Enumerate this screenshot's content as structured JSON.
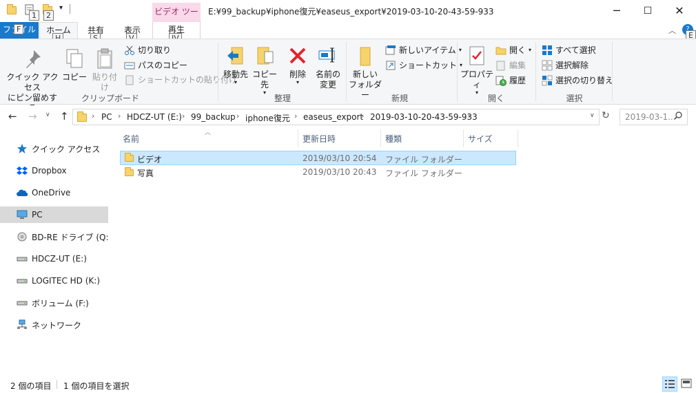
{
  "titlebar": {
    "window_title": "E:¥99_backup¥iphone復元¥easeus_export¥2019-03-10-20-43-59-933",
    "context_tab": "ビデオ ツール",
    "keytips": [
      "1",
      "2"
    ],
    "minimize": "─",
    "maximize": "☐",
    "close": "✕"
  },
  "tabs": {
    "file": "ファイル",
    "home": "ホーム",
    "share": "共有",
    "view": "表示",
    "play": "再生",
    "keytip_file": "F",
    "keytip_home": "H",
    "keytip_share": "S",
    "keytip_view": "V",
    "keytip_play": "JV",
    "keytip_help": "E",
    "collapse_icon": "chevron-up-icon",
    "help_icon": "help-icon"
  },
  "ribbon": {
    "clipboard": {
      "label": "クリップボード",
      "pin_quick_access": "クイック アクセス\nにピン留めする",
      "copy": "コピー",
      "paste": "貼り付け",
      "cut": "切り取り",
      "copy_path": "パスのコピー",
      "paste_shortcut": "ショートカットの貼り付け"
    },
    "organize": {
      "label": "整理",
      "move_to": "移動先",
      "copy_to": "コピー先",
      "delete": "削除",
      "rename": "名前の\n変更"
    },
    "new": {
      "label": "新規",
      "new_folder": "新しい\nフォルダー",
      "new_item": "新しいアイテム",
      "easy_access": "ショートカット"
    },
    "open": {
      "label": "開く",
      "properties": "プロパティ",
      "open": "開く",
      "edit": "編集",
      "history": "履歴"
    },
    "select": {
      "label": "選択",
      "select_all": "すべて選択",
      "select_none": "選択解除",
      "invert": "選択の切り替え"
    }
  },
  "address": {
    "crumbs": [
      "PC",
      "HDCZ-UT (E:)",
      "99_backup",
      "iphone復元",
      "easeus_export",
      "2019-03-10-20-43-59-933"
    ],
    "search_placeholder": "2019-03-1..."
  },
  "nav_pane": {
    "items": [
      {
        "label": "クイック アクセス",
        "icon": "star-icon"
      },
      {
        "label": "Dropbox",
        "icon": "dropbox-icon"
      },
      {
        "label": "OneDrive",
        "icon": "cloud-icon"
      },
      {
        "label": "PC",
        "icon": "computer-icon"
      },
      {
        "label": "BD-RE ドライブ (Q:) SVI",
        "icon": "disc-drive-icon"
      },
      {
        "label": "HDCZ-UT (E:)",
        "icon": "drive-icon"
      },
      {
        "label": "LOGITEC HD (K:)",
        "icon": "drive-icon"
      },
      {
        "label": "ボリューム (F:)",
        "icon": "drive-icon"
      },
      {
        "label": "ネットワーク",
        "icon": "network-icon"
      }
    ]
  },
  "file_list": {
    "columns": [
      "名前",
      "更新日時",
      "種類",
      "サイズ"
    ],
    "rows": [
      {
        "name": "ビデオ",
        "modified": "2019/03/10 20:54",
        "type": "ファイル フォルダー",
        "size": ""
      },
      {
        "name": "写真",
        "modified": "2019/03/10 20:43",
        "type": "ファイル フォルダー",
        "size": ""
      }
    ]
  },
  "status": {
    "item_count": "2 個の項目",
    "selected_count": "1 個の項目を選択"
  },
  "colors": {
    "accent": "#1979ca",
    "context_tab_bg": "#f9d9ea",
    "selection_bg": "#cce8ff",
    "selection_border": "#99d1ff",
    "folder": "#f6d36b"
  }
}
